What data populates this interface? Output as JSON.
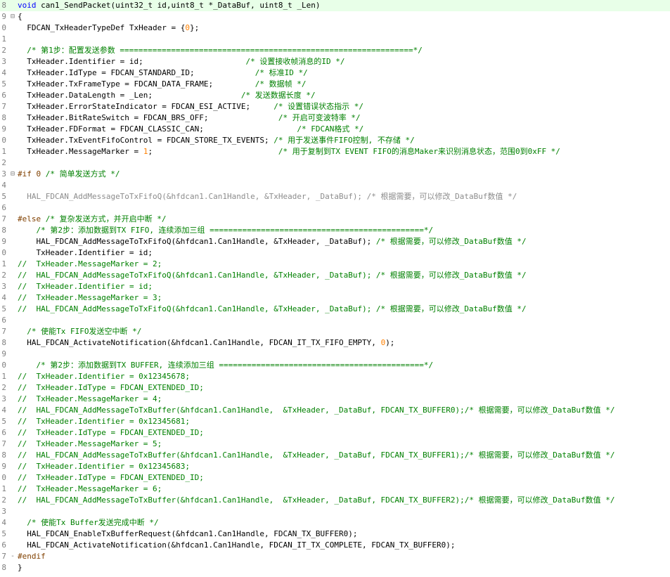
{
  "colors": {
    "keyword": "#0000ff",
    "comment": "#008000",
    "preprocessor": "#804000",
    "inactive": "#8c8c8c",
    "number": "#ff8000",
    "current_line": "#e8ffe8",
    "line_number": "#808080"
  },
  "lines": [
    {
      "num": "8",
      "fold": "",
      "current": true,
      "indent": 0,
      "segs": [
        {
          "t": "kw",
          "s": "void"
        },
        {
          "t": "tx",
          "s": " can1_SendPacket(uint32_t id,uint8_t *_DataBuf, uint8_t _Len)"
        }
      ]
    },
    {
      "num": "9",
      "fold": "⊟",
      "indent": 0,
      "segs": [
        {
          "t": "tx",
          "s": "{"
        }
      ]
    },
    {
      "num": "0",
      "fold": "",
      "indent": 2,
      "segs": [
        {
          "t": "tx",
          "s": "FDCAN_TxHeaderTypeDef TxHeader = {"
        },
        {
          "t": "nu",
          "s": "0"
        },
        {
          "t": "tx",
          "s": "};"
        }
      ]
    },
    {
      "num": "1",
      "fold": "",
      "indent": 0,
      "segs": []
    },
    {
      "num": "2",
      "fold": "",
      "indent": 2,
      "segs": [
        {
          "t": "cm",
          "s": "/* 第1步：配置发送参数 ===============================================================*/"
        }
      ]
    },
    {
      "num": "3",
      "fold": "",
      "indent": 2,
      "segs": [
        {
          "t": "tx",
          "s": "TxHeader.Identifier = id;                      "
        },
        {
          "t": "cm",
          "s": "/* 设置接收帧消息的ID */"
        }
      ]
    },
    {
      "num": "4",
      "fold": "",
      "indent": 2,
      "segs": [
        {
          "t": "tx",
          "s": "TxHeader.IdType = FDCAN_STANDARD_ID;             "
        },
        {
          "t": "cm",
          "s": "/* 标准ID */"
        }
      ]
    },
    {
      "num": "5",
      "fold": "",
      "indent": 2,
      "segs": [
        {
          "t": "tx",
          "s": "TxHeader.TxFrameType = FDCAN_DATA_FRAME;         "
        },
        {
          "t": "cm",
          "s": "/* 数据帧 */"
        }
      ]
    },
    {
      "num": "6",
      "fold": "",
      "indent": 2,
      "segs": [
        {
          "t": "tx",
          "s": "TxHeader.DataLength = _Len;                   "
        },
        {
          "t": "cm",
          "s": "/* 发送数据长度 */"
        }
      ]
    },
    {
      "num": "7",
      "fold": "",
      "indent": 2,
      "segs": [
        {
          "t": "tx",
          "s": "TxHeader.ErrorStateIndicator = FDCAN_ESI_ACTIVE;     "
        },
        {
          "t": "cm",
          "s": "/* 设置错误状态指示 */"
        }
      ]
    },
    {
      "num": "8",
      "fold": "",
      "indent": 2,
      "segs": [
        {
          "t": "tx",
          "s": "TxHeader.BitRateSwitch = FDCAN_BRS_OFF;               "
        },
        {
          "t": "cm",
          "s": "/* 开启可变波特率 */"
        }
      ]
    },
    {
      "num": "9",
      "fold": "",
      "indent": 2,
      "segs": [
        {
          "t": "tx",
          "s": "TxHeader.FDFormat = FDCAN_CLASSIC_CAN;                    "
        },
        {
          "t": "cm",
          "s": "/* FDCAN格式 */"
        }
      ]
    },
    {
      "num": "0",
      "fold": "",
      "indent": 2,
      "segs": [
        {
          "t": "tx",
          "s": "TxHeader.TxEventFifoControl = FDCAN_STORE_TX_EVENTS; "
        },
        {
          "t": "cm",
          "s": "/* 用于发送事件FIFO控制, 不存储 */"
        }
      ]
    },
    {
      "num": "1",
      "fold": "",
      "indent": 2,
      "segs": [
        {
          "t": "tx",
          "s": "TxHeader.MessageMarker = "
        },
        {
          "t": "nu",
          "s": "1"
        },
        {
          "t": "tx",
          "s": ";                           "
        },
        {
          "t": "cm",
          "s": "/* 用于复制到TX EVENT FIFO的消息Maker来识别消息状态，范围0到0xFF */"
        }
      ]
    },
    {
      "num": "2",
      "fold": "",
      "indent": 0,
      "segs": []
    },
    {
      "num": "3",
      "fold": "⊟",
      "indent": 0,
      "segs": [
        {
          "t": "pp",
          "s": "#if 0 "
        },
        {
          "t": "cm",
          "s": "/* 简单发送方式 */"
        }
      ]
    },
    {
      "num": "4",
      "fold": "",
      "indent": 0,
      "segs": []
    },
    {
      "num": "5",
      "fold": "",
      "indent": 2,
      "segs": [
        {
          "t": "ia",
          "s": "HAL_FDCAN_AddMessageToTxFifoQ(&hfdcan1.Can1Handle, &TxHeader, _DataBuf); /* 根据需要，可以修改_DataBuf数值 */"
        }
      ]
    },
    {
      "num": "6",
      "fold": "",
      "indent": 0,
      "segs": []
    },
    {
      "num": "7",
      "fold": "",
      "indent": 0,
      "segs": [
        {
          "t": "pp",
          "s": "#else "
        },
        {
          "t": "cm",
          "s": "/* 复杂发送方式，并开启中断 */"
        }
      ]
    },
    {
      "num": "8",
      "fold": "",
      "indent": 4,
      "segs": [
        {
          "t": "cm",
          "s": "/* 第2步：添加数据到TX FIFO, 连续添加三组 ==============================================*/"
        }
      ]
    },
    {
      "num": "9",
      "fold": "",
      "indent": 4,
      "segs": [
        {
          "t": "tx",
          "s": "HAL_FDCAN_AddMessageToTxFifoQ(&hfdcan1.Can1Handle, &TxHeader, _DataBuf); "
        },
        {
          "t": "cm",
          "s": "/* 根据需要，可以修改_DataBuf数值 */"
        }
      ]
    },
    {
      "num": "0",
      "fold": "",
      "indent": 4,
      "segs": [
        {
          "t": "tx",
          "s": "TxHeader.Identifier = id;"
        }
      ]
    },
    {
      "num": "1",
      "fold": "",
      "indent": 0,
      "segs": [
        {
          "t": "cm",
          "s": "//  TxHeader.MessageMarker = 2;"
        }
      ]
    },
    {
      "num": "2",
      "fold": "",
      "indent": 0,
      "segs": [
        {
          "t": "cm",
          "s": "//  HAL_FDCAN_AddMessageToTxFifoQ(&hfdcan1.Can1Handle, &TxHeader, _DataBuf); /* 根据需要，可以修改_DataBuf数值 */"
        }
      ]
    },
    {
      "num": "3",
      "fold": "",
      "indent": 0,
      "segs": [
        {
          "t": "cm",
          "s": "//  TxHeader.Identifier = id;"
        }
      ]
    },
    {
      "num": "4",
      "fold": "",
      "indent": 0,
      "segs": [
        {
          "t": "cm",
          "s": "//  TxHeader.MessageMarker = 3;"
        }
      ]
    },
    {
      "num": "5",
      "fold": "",
      "indent": 0,
      "segs": [
        {
          "t": "cm",
          "s": "//  HAL_FDCAN_AddMessageToTxFifoQ(&hfdcan1.Can1Handle, &TxHeader, _DataBuf); /* 根据需要，可以修改_DataBuf数值 */"
        }
      ]
    },
    {
      "num": "6",
      "fold": "",
      "indent": 0,
      "segs": []
    },
    {
      "num": "7",
      "fold": "",
      "indent": 2,
      "segs": [
        {
          "t": "cm",
          "s": "/* 使能Tx FIFO发送空中断 */"
        }
      ]
    },
    {
      "num": "8",
      "fold": "",
      "indent": 2,
      "segs": [
        {
          "t": "tx",
          "s": "HAL_FDCAN_ActivateNotification(&hfdcan1.Can1Handle, FDCAN_IT_TX_FIFO_EMPTY, "
        },
        {
          "t": "nu",
          "s": "0"
        },
        {
          "t": "tx",
          "s": ");"
        }
      ]
    },
    {
      "num": "9",
      "fold": "",
      "indent": 0,
      "segs": []
    },
    {
      "num": "0",
      "fold": "",
      "indent": 4,
      "segs": [
        {
          "t": "cm",
          "s": "/* 第2步：添加数据到TX BUFFER, 连续添加三组 ============================================*/"
        }
      ]
    },
    {
      "num": "1",
      "fold": "",
      "indent": 0,
      "segs": [
        {
          "t": "cm",
          "s": "//  TxHeader.Identifier = 0x12345678;"
        }
      ]
    },
    {
      "num": "2",
      "fold": "",
      "indent": 0,
      "segs": [
        {
          "t": "cm",
          "s": "//  TxHeader.IdType = FDCAN_EXTENDED_ID;"
        }
      ]
    },
    {
      "num": "3",
      "fold": "",
      "indent": 0,
      "segs": [
        {
          "t": "cm",
          "s": "//  TxHeader.MessageMarker = 4;"
        }
      ]
    },
    {
      "num": "4",
      "fold": "",
      "indent": 0,
      "segs": [
        {
          "t": "cm",
          "s": "//  HAL_FDCAN_AddMessageToTxBuffer(&hfdcan1.Can1Handle,  &TxHeader, _DataBuf, FDCAN_TX_BUFFER0);/* 根据需要，可以修改_DataBuf数值 */"
        }
      ]
    },
    {
      "num": "5",
      "fold": "",
      "indent": 0,
      "segs": [
        {
          "t": "cm",
          "s": "//  TxHeader.Identifier = 0x12345681;"
        }
      ]
    },
    {
      "num": "6",
      "fold": "",
      "indent": 0,
      "segs": [
        {
          "t": "cm",
          "s": "//  TxHeader.IdType = FDCAN_EXTENDED_ID;"
        }
      ]
    },
    {
      "num": "7",
      "fold": "",
      "indent": 0,
      "segs": [
        {
          "t": "cm",
          "s": "//  TxHeader.MessageMarker = 5;"
        }
      ]
    },
    {
      "num": "8",
      "fold": "",
      "indent": 0,
      "segs": [
        {
          "t": "cm",
          "s": "//  HAL_FDCAN_AddMessageToTxBuffer(&hfdcan1.Can1Handle,  &TxHeader, _DataBuf, FDCAN_TX_BUFFER1);/* 根据需要，可以修改_DataBuf数值 */"
        }
      ]
    },
    {
      "num": "9",
      "fold": "",
      "indent": 0,
      "segs": [
        {
          "t": "cm",
          "s": "//  TxHeader.Identifier = 0x12345683;"
        }
      ]
    },
    {
      "num": "0",
      "fold": "",
      "indent": 0,
      "segs": [
        {
          "t": "cm",
          "s": "//  TxHeader.IdType = FDCAN_EXTENDED_ID;"
        }
      ]
    },
    {
      "num": "1",
      "fold": "",
      "indent": 0,
      "segs": [
        {
          "t": "cm",
          "s": "//  TxHeader.MessageMarker = 6;"
        }
      ]
    },
    {
      "num": "2",
      "fold": "",
      "indent": 0,
      "segs": [
        {
          "t": "cm",
          "s": "//  HAL_FDCAN_AddMessageToTxBuffer(&hfdcan1.Can1Handle,  &TxHeader, _DataBuf, FDCAN_TX_BUFFER2);/* 根据需要，可以修改_DataBuf数值 */"
        }
      ]
    },
    {
      "num": "3",
      "fold": "",
      "indent": 0,
      "segs": []
    },
    {
      "num": "4",
      "fold": "",
      "indent": 2,
      "segs": [
        {
          "t": "cm",
          "s": "/* 使能Tx Buffer发送完成中断 */"
        }
      ]
    },
    {
      "num": "5",
      "fold": "",
      "indent": 2,
      "segs": [
        {
          "t": "tx",
          "s": "HAL_FDCAN_EnableTxBufferRequest(&hfdcan1.Can1Handle, FDCAN_TX_BUFFER0);"
        }
      ]
    },
    {
      "num": "6",
      "fold": "",
      "indent": 2,
      "segs": [
        {
          "t": "tx",
          "s": "HAL_FDCAN_ActivateNotification(&hfdcan1.Can1Handle, FDCAN_IT_TX_COMPLETE, FDCAN_TX_BUFFER0);"
        }
      ]
    },
    {
      "num": "7",
      "fold": "-",
      "indent": 0,
      "segs": [
        {
          "t": "pp",
          "s": "#endif"
        }
      ]
    },
    {
      "num": "8",
      "fold": "",
      "indent": 0,
      "segs": [
        {
          "t": "tx",
          "s": "}"
        }
      ]
    }
  ]
}
